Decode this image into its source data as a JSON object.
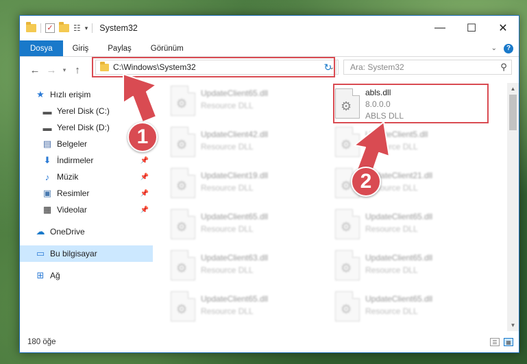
{
  "window": {
    "title": "System32",
    "minimize": "—",
    "maximize": "☐",
    "close": "✕"
  },
  "ribbon": {
    "tabs": [
      "Dosya",
      "Giriş",
      "Paylaş",
      "Görünüm"
    ],
    "help": "?"
  },
  "navigation": {
    "address": "C:\\Windows\\System32",
    "search_placeholder": "Ara: System32"
  },
  "sidebar": {
    "quick_access": "Hızlı erişim",
    "quick_items": [
      {
        "label": "Yerel Disk (C:)",
        "icon": "drive-icon",
        "pinned": true
      },
      {
        "label": "Yerel Disk (D:)",
        "icon": "drive-icon",
        "pinned": true
      },
      {
        "label": "Belgeler",
        "icon": "documents-icon",
        "pinned": true
      },
      {
        "label": "İndirmeler",
        "icon": "downloads-icon",
        "pinned": true
      },
      {
        "label": "Müzik",
        "icon": "music-icon",
        "pinned": true
      },
      {
        "label": "Resimler",
        "icon": "pictures-icon",
        "pinned": true
      },
      {
        "label": "Videolar",
        "icon": "videos-icon",
        "pinned": true
      }
    ],
    "onedrive": "OneDrive",
    "this_pc": "Bu bilgisayar",
    "network": "Ağ"
  },
  "files": {
    "left_column": [
      {
        "name": "UpdateClient65.dll",
        "type": "Resource DLL"
      },
      {
        "name": "UpdateClient42.dll",
        "type": "Resource DLL"
      },
      {
        "name": "UpdateClient19.dll",
        "type": "Resource DLL"
      },
      {
        "name": "UpdateClient65.dll",
        "type": "Resource DLL"
      },
      {
        "name": "UpdateClient63.dll",
        "type": "Resource DLL"
      },
      {
        "name": "UpdateClient65.dll",
        "type": "Resource DLL"
      }
    ],
    "highlighted": {
      "name": "abls.dll",
      "version": "8.0.0.0",
      "type": "ABLS DLL"
    },
    "right_column": [
      {
        "name": "UpdateClient5.dll",
        "type": "Resource DLL"
      },
      {
        "name": "UpdateClient21.dll",
        "type": "Resource DLL"
      },
      {
        "name": "UpdateClient65.dll",
        "type": "Resource DLL"
      },
      {
        "name": "UpdateClient65.dll",
        "type": "Resource DLL"
      },
      {
        "name": "UpdateClient65.dll",
        "type": "Resource DLL"
      }
    ]
  },
  "status": {
    "item_count": "180 öğe"
  },
  "annotations": {
    "step1": "1",
    "step2": "2",
    "color": "#d94b52"
  }
}
